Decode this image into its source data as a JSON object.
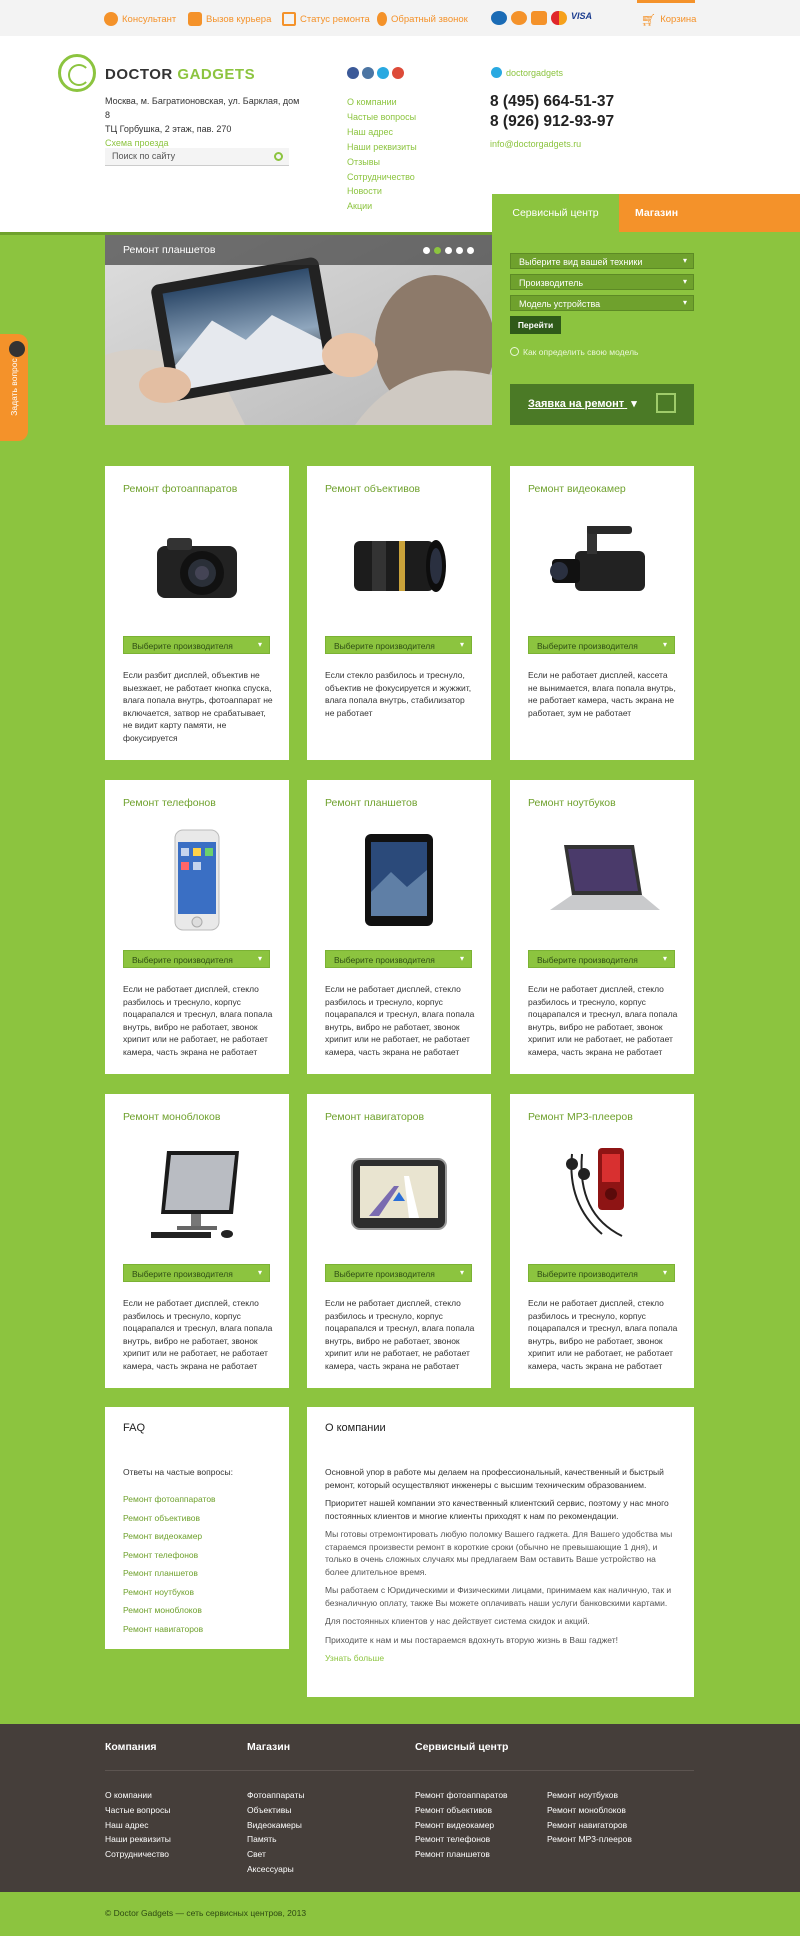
{
  "topbar": {
    "items": [
      "Консультант",
      "Вызов курьера",
      "Статус ремонта",
      "Обратный звонок"
    ],
    "pay_visa": "VISA",
    "cart": "Корзина"
  },
  "brand": {
    "logo_part1": "DOCTOR",
    "logo_part2": "GADGETS"
  },
  "address": {
    "line1": "Москва, м. Багратионовская, ул. Барклая, дом 8",
    "line2": "ТЦ Горбушка, 2 этаж, пав. 270",
    "map_link": "Схема проезда"
  },
  "search": {
    "placeholder": "Поиск по сайту"
  },
  "header_nav": [
    "О компании",
    "Частые вопросы",
    "Наш адрес",
    "Наши реквизиты",
    "Отзывы",
    "Сотрудничество",
    "Новости",
    "Акции"
  ],
  "contacts": {
    "skype": "doctorgadgets",
    "phone1": "8 (495) 664-51-37",
    "phone2": "8 (926) 912-93-97",
    "email": "info@doctorgadgets.ru"
  },
  "tabs": {
    "service": "Сервисный центр",
    "shop": "Магазин"
  },
  "slider": {
    "caption": "Ремонт планшетов",
    "dots": 5,
    "active_dot": 2
  },
  "finder": {
    "select1": "Выберите вид вашей техники",
    "select2": "Производитель",
    "select3": "Модель устройства",
    "go": "Перейти",
    "howto": "Как определить свою модель",
    "request": "Заявка на ремонт"
  },
  "side_tab": "Задать вопрос",
  "cards": [
    {
      "title": "Ремонт фотоаппаратов",
      "select": "Выберите производителя",
      "text": "Если разбит дисплей, объектив не выезжает, не работает кнопка спуска, влага попала внутрь, фотоаппарат не включается, затвор не срабатывает, не видит карту памяти, не фокусируется"
    },
    {
      "title": "Ремонт объективов",
      "select": "Выберите производителя",
      "text": "Если стекло разбилось и треснуло, объектив не фокусируется и жужжит, влага попала внутрь, стабилизатор не работает"
    },
    {
      "title": "Ремонт видеокамер",
      "select": "Выберите производителя",
      "text": "Если не работает дисплей, кассета не вынимается, влага попала внутрь, не работает камера, часть экрана не работает, зум не работает"
    },
    {
      "title": "Ремонт телефонов",
      "select": "Выберите производителя",
      "text": "Если не работает дисплей, стекло разбилось и треснуло, корпус поцарапался и треснул, влага попала внутрь, вибро не работает, звонок хрипит или не работает, не работает камера, часть экрана не работает"
    },
    {
      "title": "Ремонт планшетов",
      "select": "Выберите производителя",
      "text": "Если не работает дисплей, стекло разбилось и треснуло, корпус поцарапался и треснул, влага попала внутрь, вибро не работает, звонок хрипит или не работает, не работает камера, часть экрана не работает"
    },
    {
      "title": "Ремонт ноутбуков",
      "select": "Выберите производителя",
      "text": "Если не работает дисплей, стекло разбилось и треснуло, корпус поцарапался и треснул, влага попала внутрь, вибро не работает, звонок хрипит или не работает, не работает камера, часть экрана не работает"
    },
    {
      "title": "Ремонт моноблоков",
      "select": "Выберите производителя",
      "text": "Если не работает дисплей, стекло разбилось и треснуло, корпус поцарапался и треснул, влага попала внутрь, вибро не работает, звонок хрипит или не работает, не работает камера, часть экрана не работает"
    },
    {
      "title": "Ремонт навигаторов",
      "select": "Выберите производителя",
      "text": "Если не работает дисплей, стекло разбилось и треснуло, корпус поцарапался и треснул, влага попала внутрь, вибро не работает, звонок хрипит или не работает, не работает камера, часть экрана не работает"
    },
    {
      "title": "Ремонт MP3-плееров",
      "select": "Выберите производителя",
      "text": "Если не работает дисплей, стекло разбилось и треснуло, корпус поцарапался и треснул, влага попала внутрь, вибро не работает, звонок хрипит или не работает, не работает камера, часть экрана не работает"
    }
  ],
  "faq": {
    "title": "FAQ",
    "intro": "Ответы на частые вопросы:",
    "links": [
      "Ремонт фотоаппаратов",
      "Ремонт объективов",
      "Ремонт видеокамер",
      "Ремонт телефонов",
      "Ремонт планшетов",
      "Ремонт ноутбуков",
      "Ремонт моноблоков",
      "Ремонт навигаторов"
    ]
  },
  "about": {
    "title": "О компании",
    "p1": "Основной упор в работе мы делаем на профессиональный, качественный и быстрый ремонт, который осуществляют инженеры с высшим техническим образованием.",
    "p2": "Приоритет нашей компании это качественный клиентский сервис, поэтому у нас много постоянных клиентов и многие клиенты приходят к нам по рекомендации.",
    "p3": "Мы готовы отремонтировать любую поломку Вашего гаджета. Для Вашего удобства мы стараемся произвести ремонт в короткие сроки (обычно не превышающие 1 дня), и только в очень сложных случаях мы предлагаем Вам оставить Ваше устройство на более длительное время.",
    "p4": "Мы работаем с Юридическими и Физическими лицами, принимаем как наличную, так и безналичную оплату, также Вы можете оплачивать наши услуги банковскими картами.",
    "p5": "Для постоянных клиентов у нас действует система скидок и акций.",
    "p6": "Приходите к нам и мы постараемся вдохнуть вторую жизнь в Ваш гаджет!",
    "more": "Узнать больше"
  },
  "footer": {
    "col1_title": "Компания",
    "col1": [
      "О компании",
      "Частые вопросы",
      "Наш адрес",
      "Наши реквизиты",
      "Сотрудничество"
    ],
    "col2_title": "Магазин",
    "col2": [
      "Фотоаппараты",
      "Объективы",
      "Видеокамеры",
      "Память",
      "Свет",
      "Аксессуары"
    ],
    "col3_title": "Сервисный центр",
    "col3a": [
      "Ремонт фотоаппаратов",
      "Ремонт объективов",
      "Ремонт видеокамер",
      "Ремонт телефонов",
      "Ремонт планшетов"
    ],
    "col3b": [
      "Ремонт ноутбуков",
      "Ремонт моноблоков",
      "Ремонт навигаторов",
      "Ремонт МР3-плееров"
    ],
    "copyright": "© Doctor Gadgets — сеть сервисных центров, 2013"
  },
  "colors": {
    "green": "#8cc43f",
    "dark_green": "#4b7a26",
    "orange": "#f4922a",
    "footer_bg": "#453e3a"
  }
}
